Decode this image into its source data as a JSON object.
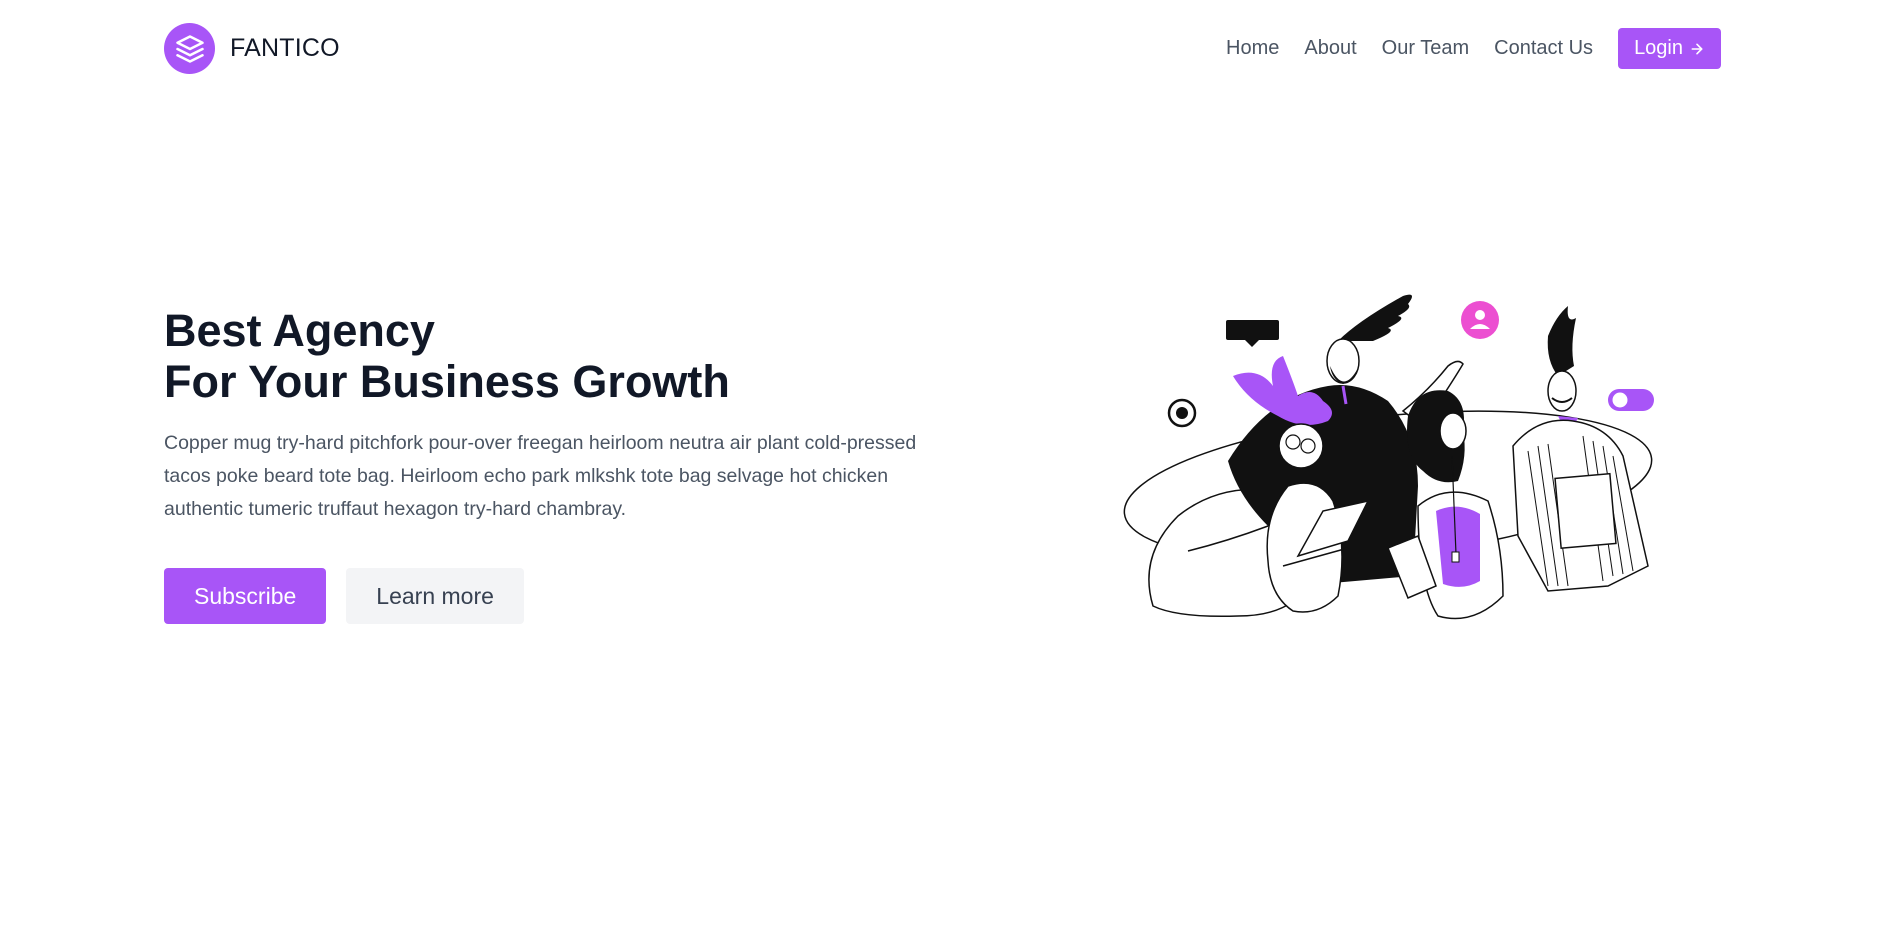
{
  "brand": {
    "name": "FANTICO",
    "logo_icon": "layers-icon",
    "color": "#a855f7"
  },
  "nav": {
    "links": [
      "Home",
      "About",
      "Our Team",
      "Contact Us"
    ],
    "login_label": "Login",
    "login_icon": "arrow-right-icon"
  },
  "hero": {
    "title_line1": "Best Agency",
    "title_line2": "For Your Business Growth",
    "description": "Copper mug try-hard pitchfork pour-over freegan heirloom neutra air plant cold-pressed tacos poke beard tote bag. Heirloom echo park mlkshk tote bag selvage hot chicken authentic tumeric truffaut hexagon try-hard chambray.",
    "primary_button": "Subscribe",
    "secondary_button": "Learn more"
  },
  "illustration": {
    "subject": "team-illustration",
    "accent": "#a855f7",
    "pink": "#ec4fd1"
  }
}
